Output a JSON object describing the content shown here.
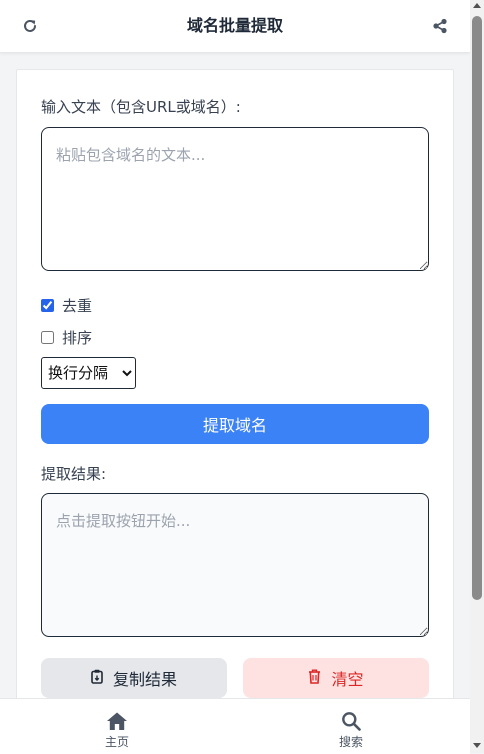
{
  "header": {
    "title": "域名批量提取",
    "refresh_icon": "refresh-icon",
    "share_icon": "share-icon"
  },
  "form": {
    "input_label": "输入文本（包含URL或域名）:",
    "input_placeholder": "粘贴包含域名的文本...",
    "input_value": "",
    "dedupe_label": "去重",
    "dedupe_checked": true,
    "sort_label": "排序",
    "sort_checked": false,
    "separator_selected": "换行分隔",
    "extract_button": "提取域名",
    "result_label": "提取结果:",
    "result_placeholder": "点击提取按钮开始...",
    "result_value": "",
    "copy_button": "复制结果",
    "clear_button": "清空"
  },
  "bottom_nav": {
    "items": [
      {
        "label": "主页",
        "icon": "home-icon"
      },
      {
        "label": "搜索",
        "icon": "search-icon"
      }
    ]
  },
  "colors": {
    "primary": "#3b82f6",
    "danger": "#dc2626",
    "danger_bg": "#fee2e2",
    "neutral_bg": "#e5e7eb"
  }
}
